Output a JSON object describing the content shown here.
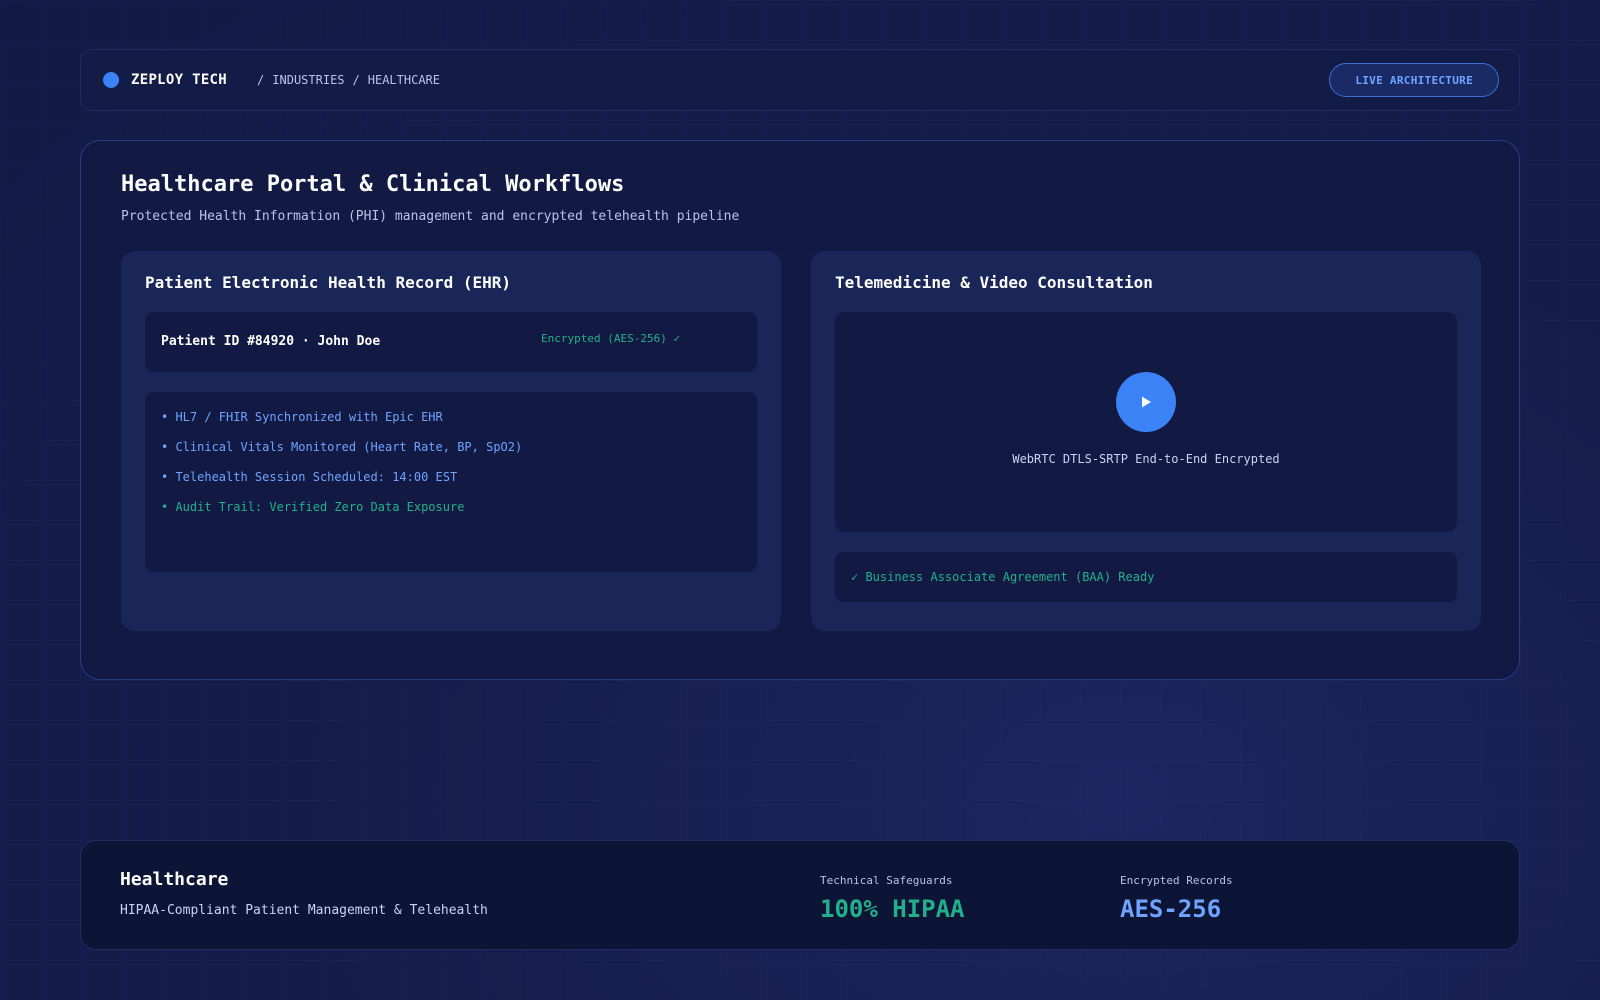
{
  "header": {
    "brand": "ZEPLOY TECH",
    "breadcrumb": [
      "INDUSTRIES",
      "HEALTHCARE"
    ],
    "separator": "/",
    "live_button": "LIVE ARCHITECTURE"
  },
  "main": {
    "title": "Healthcare Portal & Clinical Workflows",
    "subtitle": "Protected Health Information (PHI) management and encrypted telehealth pipeline"
  },
  "ehr": {
    "title": "Patient Electronic Health Record (EHR)",
    "patient": "Patient ID #84920 · John Doe",
    "encryption_badge": "Encrypted (AES-256) ✓",
    "items": [
      "• HL7 / FHIR Synchronized with Epic EHR",
      "• Clinical Vitals Monitored (Heart Rate, BP, SpO2)",
      "• Telehealth Session Scheduled: 14:00 EST",
      "• Audit Trail: Verified Zero Data Exposure"
    ]
  },
  "telemedicine": {
    "title": "Telemedicine & Video Consultation",
    "video_caption": "WebRTC DTLS-SRTP End-to-End Encrypted",
    "baa_status": "✓ Business Associate Agreement (BAA) Ready"
  },
  "footer": {
    "title": "Healthcare",
    "subtitle": "HIPAA-Compliant Patient Management & Telehealth",
    "stats": [
      {
        "label": "Technical Safeguards",
        "value": "100% HIPAA"
      },
      {
        "label": "Encrypted Records",
        "value": "AES-256"
      }
    ]
  },
  "colors": {
    "accent_blue": "#3b82f6",
    "link_blue": "#6ea4ff",
    "success_green": "#22b08a"
  },
  "icons": {
    "brand": "brand-dot-icon",
    "play": "play-icon"
  }
}
